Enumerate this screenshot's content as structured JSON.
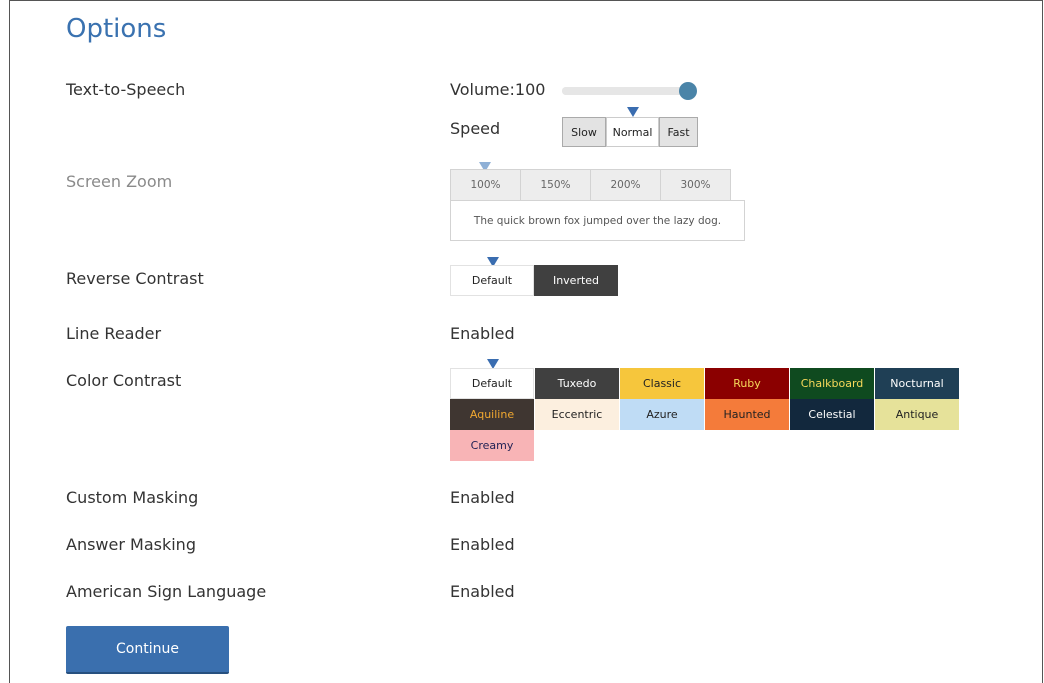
{
  "title": "Options",
  "tts": {
    "label": "Text-to-Speech",
    "volume_label": "Volume:",
    "volume_value": "100",
    "volume_level": 1.0,
    "speed_label": "Speed",
    "speed_options": [
      "Slow",
      "Normal",
      "Fast"
    ],
    "speed_selected": "Normal"
  },
  "zoom": {
    "label": "Screen Zoom",
    "options": [
      "100%",
      "150%",
      "200%",
      "300%"
    ],
    "selected": "100%",
    "preview_text": "The quick brown fox jumped over the lazy dog."
  },
  "reverse_contrast": {
    "label": "Reverse Contrast",
    "options": [
      "Default",
      "Inverted"
    ],
    "selected": "Default"
  },
  "line_reader": {
    "label": "Line Reader",
    "value": "Enabled"
  },
  "color_contrast": {
    "label": "Color Contrast",
    "selected": "Default",
    "options": [
      {
        "name": "Default",
        "bg": "#ffffff",
        "fg": "#222222"
      },
      {
        "name": "Tuxedo",
        "bg": "#404040",
        "fg": "#ffffff"
      },
      {
        "name": "Classic",
        "bg": "#f6c63c",
        "fg": "#222222"
      },
      {
        "name": "Ruby",
        "bg": "#8b0000",
        "fg": "#f6d85a"
      },
      {
        "name": "Chalkboard",
        "bg": "#0f4a1f",
        "fg": "#f6d85a"
      },
      {
        "name": "Nocturnal",
        "bg": "#1f3f55",
        "fg": "#ffffff"
      },
      {
        "name": "Aquiline",
        "bg": "#3f3631",
        "fg": "#f0a830"
      },
      {
        "name": "Eccentric",
        "bg": "#fcefdf",
        "fg": "#222222"
      },
      {
        "name": "Azure",
        "bg": "#bfdcf5",
        "fg": "#222222"
      },
      {
        "name": "Haunted",
        "bg": "#f47b3a",
        "fg": "#222222"
      },
      {
        "name": "Celestial",
        "bg": "#12283d",
        "fg": "#ffffff"
      },
      {
        "name": "Antique",
        "bg": "#e6e29a",
        "fg": "#222222"
      },
      {
        "name": "Creamy",
        "bg": "#f8b4b6",
        "fg": "#222255"
      }
    ]
  },
  "custom_masking": {
    "label": "Custom Masking",
    "value": "Enabled"
  },
  "answer_masking": {
    "label": "Answer Masking",
    "value": "Enabled"
  },
  "asl": {
    "label": "American Sign Language",
    "value": "Enabled"
  },
  "continue_label": "Continue"
}
